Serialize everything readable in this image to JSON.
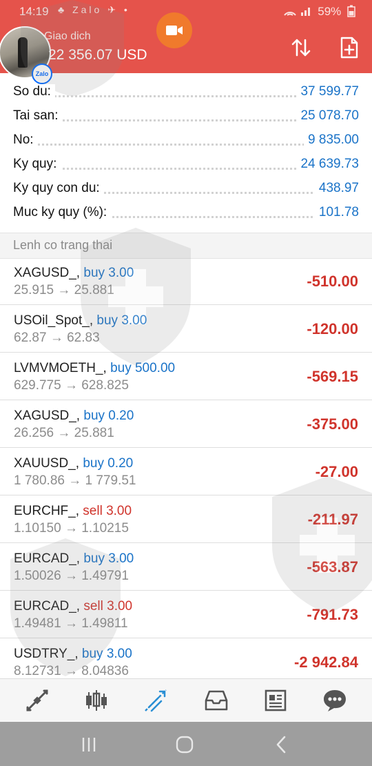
{
  "status_bar": {
    "time": "14:19",
    "left_icons": "♣ Zalo ✈ •",
    "right": "59%"
  },
  "header": {
    "title": "Giao dich",
    "balance": "22 356.07 USD",
    "zalo_badge": "Zalo",
    "accent": "#e5534b"
  },
  "summary": [
    {
      "label": "So du:",
      "value": "37 599.77"
    },
    {
      "label": "Tai san:",
      "value": "25 078.70"
    },
    {
      "label": "No:",
      "value": "9 835.00"
    },
    {
      "label": "Ky quy:",
      "value": "24 639.73"
    },
    {
      "label": "Ky quy con du:",
      "value": "438.97"
    },
    {
      "label": "Muc ky quy (%):",
      "value": "101.78"
    }
  ],
  "section_title": "Lenh co trang thai",
  "orders": [
    {
      "symbol": "XAGUSD_,",
      "side": "buy 3.00",
      "type": "buy",
      "prices": "25.915 → 25.881",
      "profit": "-510.00"
    },
    {
      "symbol": "USOil_Spot_,",
      "side": "buy 3.00",
      "type": "buy",
      "prices": "62.87 → 62.83",
      "profit": "-120.00"
    },
    {
      "symbol": "LVMVMOETH_,",
      "side": "buy 500.00",
      "type": "buy",
      "prices": "629.775 → 628.825",
      "profit": "-569.15"
    },
    {
      "symbol": "XAGUSD_,",
      "side": "buy 0.20",
      "type": "buy",
      "prices": "26.256 → 25.881",
      "profit": "-375.00"
    },
    {
      "symbol": "XAUUSD_,",
      "side": "buy 0.20",
      "type": "buy",
      "prices": "1 780.86 → 1 779.51",
      "profit": "-27.00"
    },
    {
      "symbol": "EURCHF_,",
      "side": "sell 3.00",
      "type": "sell",
      "prices": "1.10150 → 1.10215",
      "profit": "-211.97"
    },
    {
      "symbol": "EURCAD_,",
      "side": "buy 3.00",
      "type": "buy",
      "prices": "1.50026 → 1.49791",
      "profit": "-563.87"
    },
    {
      "symbol": "EURCAD_,",
      "side": "sell 3.00",
      "type": "sell",
      "prices": "1.49481 → 1.49811",
      "profit": "-791.73"
    },
    {
      "symbol": "USDTRY_,",
      "side": "buy 3.00",
      "type": "buy",
      "prices": "8.12731 → 8.04836",
      "profit": "-2 942.84"
    }
  ],
  "bottom_nav": [
    "quotes-icon",
    "chart-icon",
    "trade-icon",
    "history-icon",
    "news-icon",
    "messages-icon"
  ],
  "colors": {
    "value_blue": "#1a73c8",
    "loss_red": "#d0342c",
    "active_tab": "#2a8fd4"
  }
}
